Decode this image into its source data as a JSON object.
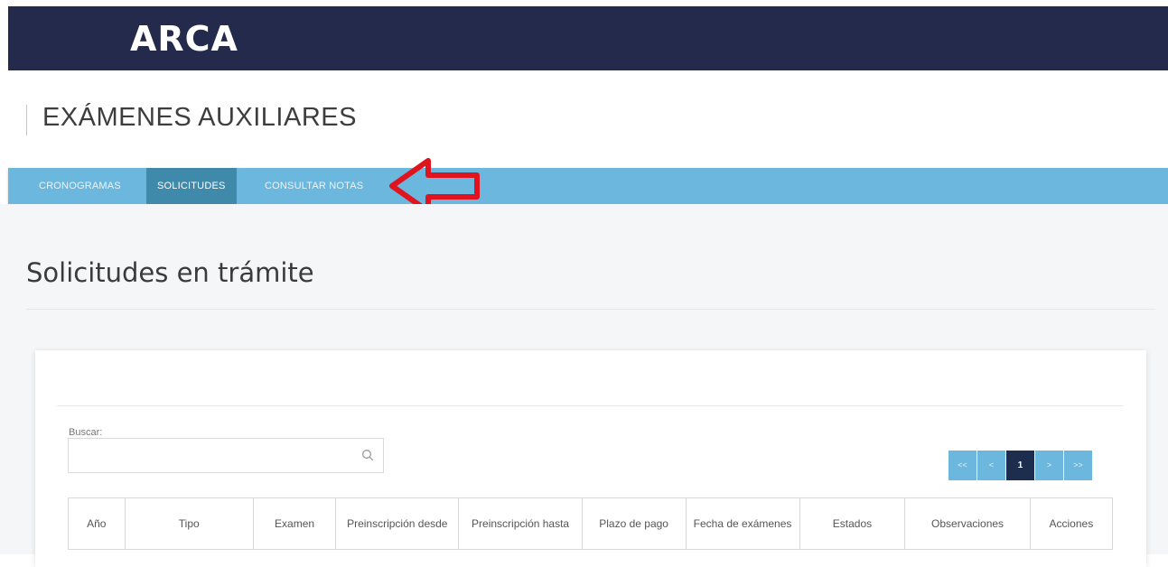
{
  "header": {
    "logo_text": "ARCA"
  },
  "page": {
    "title": "EXÁMENES AUXILIARES"
  },
  "nav": {
    "items": [
      {
        "label": "CRONOGRAMAS",
        "active": false
      },
      {
        "label": "SOLICITUDES",
        "active": true
      },
      {
        "label": "CONSULTAR NOTAS",
        "active": false
      }
    ],
    "annotation_arrow_color": "#e0141e"
  },
  "section": {
    "title": "Solicitudes en trámite"
  },
  "search": {
    "label": "Buscar:",
    "value": "",
    "icon": "search-icon"
  },
  "pagination": {
    "first": "<<",
    "prev": "<",
    "current": "1",
    "next": ">",
    "last": ">>"
  },
  "table": {
    "headers": [
      "Año",
      "Tipo",
      "Examen",
      "Preinscripción desde",
      "Preinscripción hasta",
      "Plazo de pago",
      "Fecha de exámenes",
      "Estados",
      "Observaciones",
      "Acciones"
    ]
  },
  "colors": {
    "topbar": "#232a4b",
    "navbar": "#6cb7dd",
    "nav_active": "#3f89aa",
    "pager_active": "#1d2d4e"
  }
}
